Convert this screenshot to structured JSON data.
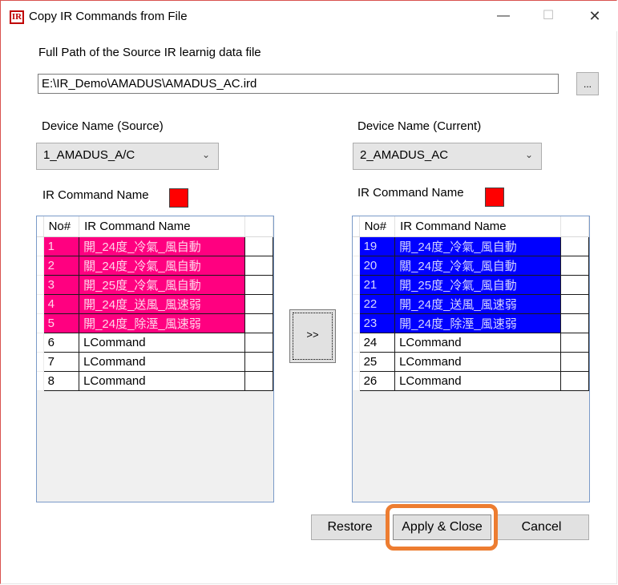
{
  "window": {
    "title": "Copy IR Commands from File",
    "icon_text": "IR",
    "minimize_glyph": "—",
    "maximize_glyph": "☐",
    "close_glyph": "✕"
  },
  "source_file": {
    "label": "Full Path of the Source IR learnig data file",
    "path": "E:\\IR_Demo\\AMADUS\\AMADUS_AC.ird",
    "browse_label": "..."
  },
  "source": {
    "device_label": "Device Name (Source)",
    "device_value": "1_AMADUS_A/C",
    "command_label": "IR Command Name",
    "color": "#ff0000",
    "selection_color": "#ff0080",
    "columns": [
      "No#",
      "IR Command Name"
    ],
    "rows": [
      {
        "no": "1",
        "name": "開_24度_冷氣_風自動",
        "selected": true
      },
      {
        "no": "2",
        "name": "關_24度_冷氣_風自動",
        "selected": true
      },
      {
        "no": "3",
        "name": "開_25度_冷氣_風自動",
        "selected": true
      },
      {
        "no": "4",
        "name": "開_24度_送風_風速弱",
        "selected": true
      },
      {
        "no": "5",
        "name": "開_24度_除溼_風速弱",
        "selected": true
      },
      {
        "no": "6",
        "name": "LCommand",
        "selected": false
      },
      {
        "no": "7",
        "name": "LCommand",
        "selected": false
      },
      {
        "no": "8",
        "name": "LCommand",
        "selected": false
      }
    ]
  },
  "current": {
    "device_label": "Device Name (Current)",
    "device_value": "2_AMADUS_AC",
    "command_label": "IR Command Name",
    "color": "#ff0000",
    "selection_color": "#0000ff",
    "columns": [
      "No#",
      "IR Command Name"
    ],
    "rows": [
      {
        "no": "19",
        "name": "開_24度_冷氣_風自動",
        "selected": true
      },
      {
        "no": "20",
        "name": "關_24度_冷氣_風自動",
        "selected": true
      },
      {
        "no": "21",
        "name": "開_25度_冷氣_風自動",
        "selected": true
      },
      {
        "no": "22",
        "name": "開_24度_送風_風速弱",
        "selected": true
      },
      {
        "no": "23",
        "name": "開_24度_除溼_風速弱",
        "selected": true
      },
      {
        "no": "24",
        "name": "LCommand",
        "selected": false
      },
      {
        "no": "25",
        "name": "LCommand",
        "selected": false
      },
      {
        "no": "26",
        "name": "LCommand",
        "selected": false
      }
    ]
  },
  "transfer_label": ">>",
  "buttons": {
    "restore": "Restore",
    "apply_close": "Apply & Close",
    "cancel": "Cancel"
  },
  "highlight_color": "#ed7d31"
}
